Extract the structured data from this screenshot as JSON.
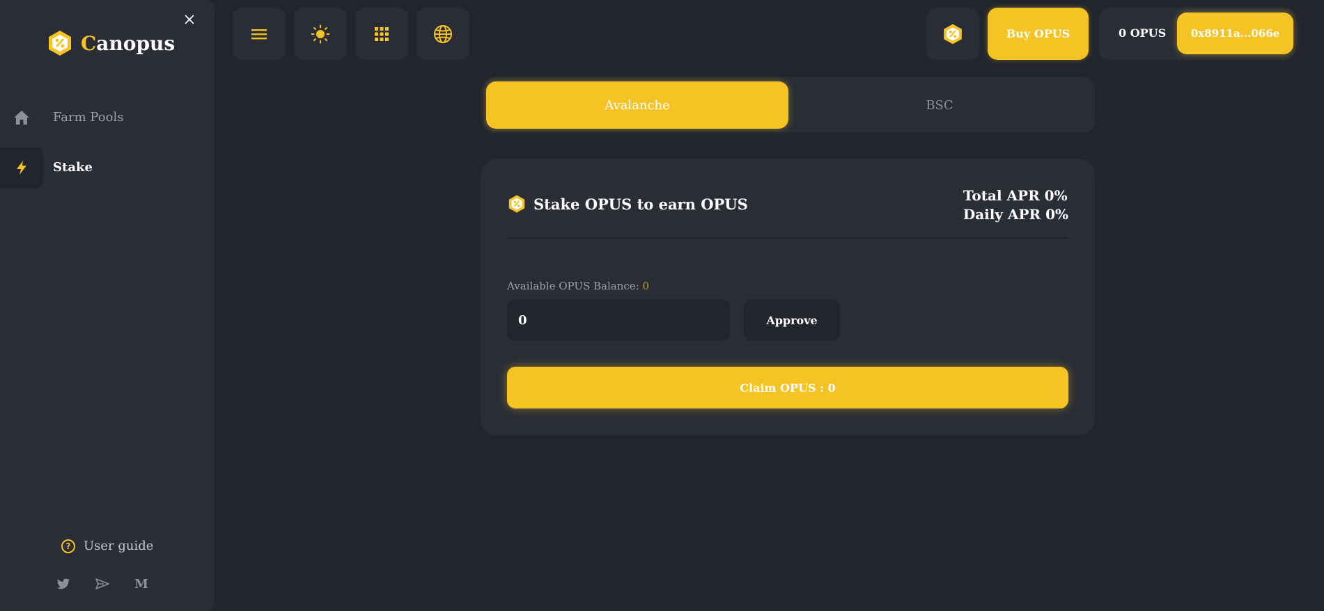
{
  "brand": {
    "name_first": "C",
    "name_rest": "anopus",
    "accent": "#f5c324"
  },
  "sidebar": {
    "items": [
      {
        "label": "Farm Pools",
        "icon": "home-icon"
      },
      {
        "label": "Stake",
        "icon": "lightning-icon"
      }
    ],
    "user_guide": "User guide",
    "socials": [
      "twitter-icon",
      "telegram-icon",
      "medium-icon"
    ],
    "medium_glyph": "M"
  },
  "topbar": {
    "buy_label": "Buy OPUS",
    "balance_label": "0 OPUS",
    "address_label": "0x8911a...066e"
  },
  "network": {
    "tabs": [
      "Avalanche",
      "BSC"
    ],
    "selected": "Avalanche"
  },
  "stake": {
    "title": "Stake OPUS to earn OPUS",
    "total_apr": "Total APR 0%",
    "daily_apr": "Daily APR 0%",
    "balance_label": "Available OPUS Balance: ",
    "balance_value": "0",
    "input_value": "0",
    "approve_label": "Approve",
    "claim_label": "Claim OPUS : 0"
  }
}
